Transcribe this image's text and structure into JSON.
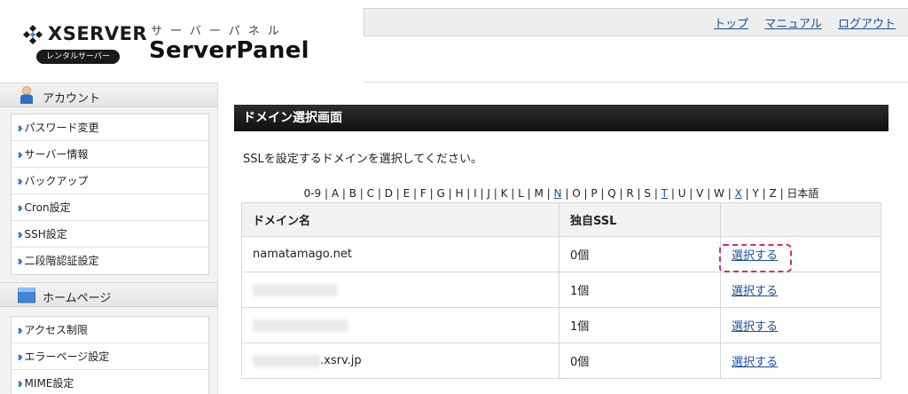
{
  "brand": {
    "company": "XSERVER",
    "pill": "レンタルサーバー",
    "product_kana": "サーバーパネル",
    "product": "ServerPanel"
  },
  "top_links": [
    "トップ",
    "マニュアル",
    "ログアウト"
  ],
  "sidebar": {
    "sections": [
      {
        "heading": "アカウント",
        "icon": "person-icon",
        "items": [
          "パスワード変更",
          "サーバー情報",
          "バックアップ",
          "Cron設定",
          "SSH設定",
          "二段階認証設定"
        ]
      },
      {
        "heading": "ホームページ",
        "icon": "folder-icon",
        "items": [
          "アクセス制限",
          "エラーページ設定",
          "MIME設定"
        ]
      }
    ]
  },
  "main": {
    "title": "ドメイン選択画面",
    "instruction": "SSLを設定するドメインを選択してください。",
    "alpha_index": [
      {
        "t": "0-9",
        "link": false
      },
      {
        "t": "A",
        "link": false
      },
      {
        "t": "B",
        "link": false
      },
      {
        "t": "C",
        "link": false
      },
      {
        "t": "D",
        "link": false
      },
      {
        "t": "E",
        "link": false
      },
      {
        "t": "F",
        "link": false
      },
      {
        "t": "G",
        "link": false
      },
      {
        "t": "H",
        "link": false
      },
      {
        "t": "I",
        "link": false
      },
      {
        "t": "J",
        "link": false
      },
      {
        "t": "K",
        "link": false
      },
      {
        "t": "L",
        "link": false
      },
      {
        "t": "M",
        "link": false
      },
      {
        "t": "N",
        "link": true
      },
      {
        "t": "O",
        "link": false
      },
      {
        "t": "P",
        "link": false
      },
      {
        "t": "Q",
        "link": false
      },
      {
        "t": "R",
        "link": false
      },
      {
        "t": "S",
        "link": false
      },
      {
        "t": "T",
        "link": true
      },
      {
        "t": "U",
        "link": false
      },
      {
        "t": "V",
        "link": false
      },
      {
        "t": "W",
        "link": false
      },
      {
        "t": "X",
        "link": true
      },
      {
        "t": "Y",
        "link": false
      },
      {
        "t": "Z",
        "link": false
      },
      {
        "t": "日本語",
        "link": false
      }
    ],
    "table": {
      "headers": [
        "ドメイン名",
        "独自SSL",
        ""
      ],
      "rows": [
        {
          "domain": "namatamago.net",
          "ssl": "0個",
          "action": "選択する"
        },
        {
          "domain": "",
          "ssl": "1個",
          "action": "選択する"
        },
        {
          "domain": "",
          "ssl": "1個",
          "action": "選択する"
        },
        {
          "domain": ".xsrv.jp",
          "ssl": "0個",
          "action": "選択する"
        }
      ]
    }
  },
  "colors": {
    "link": "#1a4f9c",
    "title_bar": "#1a1a1a",
    "highlight": "#d0306e"
  }
}
